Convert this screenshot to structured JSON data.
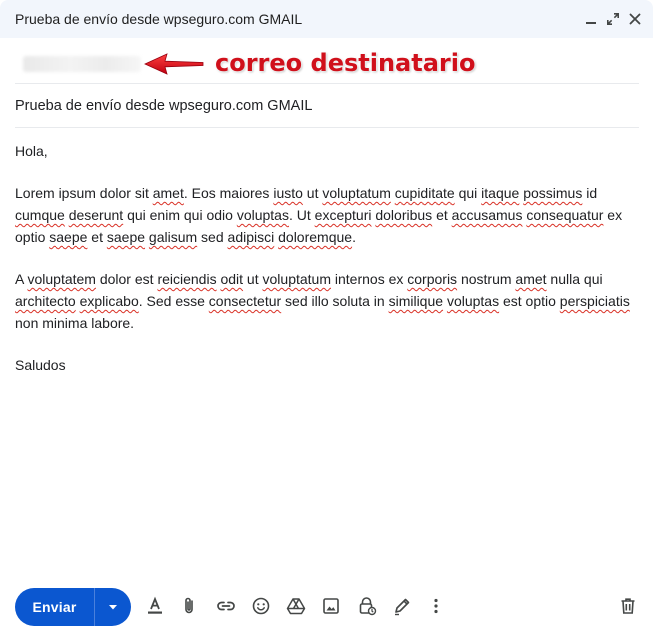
{
  "window": {
    "title": "Prueba de envío desde wpseguro.com GMAIL"
  },
  "recipient": {
    "annotation": "correo destinatario"
  },
  "subject": "Prueba de envío desde wpseguro.com GMAIL",
  "body": {
    "greeting": "Hola,",
    "paragraph1": [
      {
        "t": "Lorem ipsum dolor sit "
      },
      {
        "t": "amet",
        "s": true
      },
      {
        "t": ". Eos maiores "
      },
      {
        "t": "iusto",
        "s": true
      },
      {
        "t": " ut "
      },
      {
        "t": "voluptatum",
        "s": true
      },
      {
        "t": " "
      },
      {
        "t": "cupiditate",
        "s": true
      },
      {
        "t": " qui "
      },
      {
        "t": "itaque",
        "s": true
      },
      {
        "t": " "
      },
      {
        "t": "possimus",
        "s": true
      },
      {
        "t": " id "
      },
      {
        "t": "cumque",
        "s": true
      },
      {
        "t": " "
      },
      {
        "t": "deserunt",
        "s": true
      },
      {
        "t": " qui enim qui odio "
      },
      {
        "t": "voluptas",
        "s": true
      },
      {
        "t": ". Ut "
      },
      {
        "t": "excepturi",
        "s": true
      },
      {
        "t": " "
      },
      {
        "t": "doloribus",
        "s": true
      },
      {
        "t": " et "
      },
      {
        "t": "accusamus",
        "s": true
      },
      {
        "t": " "
      },
      {
        "t": "consequatur",
        "s": true
      },
      {
        "t": " ex optio "
      },
      {
        "t": "saepe",
        "s": true
      },
      {
        "t": " et "
      },
      {
        "t": "saepe",
        "s": true
      },
      {
        "t": " "
      },
      {
        "t": "galisum",
        "s": true
      },
      {
        "t": " sed "
      },
      {
        "t": "adipisci",
        "s": true
      },
      {
        "t": " "
      },
      {
        "t": "doloremque",
        "s": true
      },
      {
        "t": "."
      }
    ],
    "paragraph2": [
      {
        "t": "A "
      },
      {
        "t": "voluptatem",
        "s": true
      },
      {
        "t": " dolor est "
      },
      {
        "t": "reiciendis",
        "s": true
      },
      {
        "t": " "
      },
      {
        "t": "odit",
        "s": true
      },
      {
        "t": " ut "
      },
      {
        "t": "voluptatum",
        "s": true
      },
      {
        "t": " internos ex "
      },
      {
        "t": "corporis",
        "s": true
      },
      {
        "t": " nostrum "
      },
      {
        "t": "amet",
        "s": true
      },
      {
        "t": " nulla qui "
      },
      {
        "t": "architecto",
        "s": true
      },
      {
        "t": " "
      },
      {
        "t": "explicabo",
        "s": true
      },
      {
        "t": ". Sed esse "
      },
      {
        "t": "consectetur",
        "s": true
      },
      {
        "t": " sed illo soluta in "
      },
      {
        "t": "similique",
        "s": true
      },
      {
        "t": " "
      },
      {
        "t": "voluptas",
        "s": true
      },
      {
        "t": " est optio "
      },
      {
        "t": "perspiciatis",
        "s": true
      },
      {
        "t": " non minima labore."
      }
    ],
    "closing": "Saludos"
  },
  "toolbar": {
    "send_label": "Enviar",
    "icons": [
      "text-format-icon",
      "attach-icon",
      "link-icon",
      "emoji-icon",
      "drive-icon",
      "photo-icon",
      "confidential-lock-icon",
      "signature-pen-icon",
      "more-options-icon",
      "trash-icon"
    ]
  },
  "colors": {
    "send_button": "#0b57d0",
    "titlebar": "#f2f6fc",
    "annotation": "#d0101b",
    "spellcheck": "#d93025"
  }
}
